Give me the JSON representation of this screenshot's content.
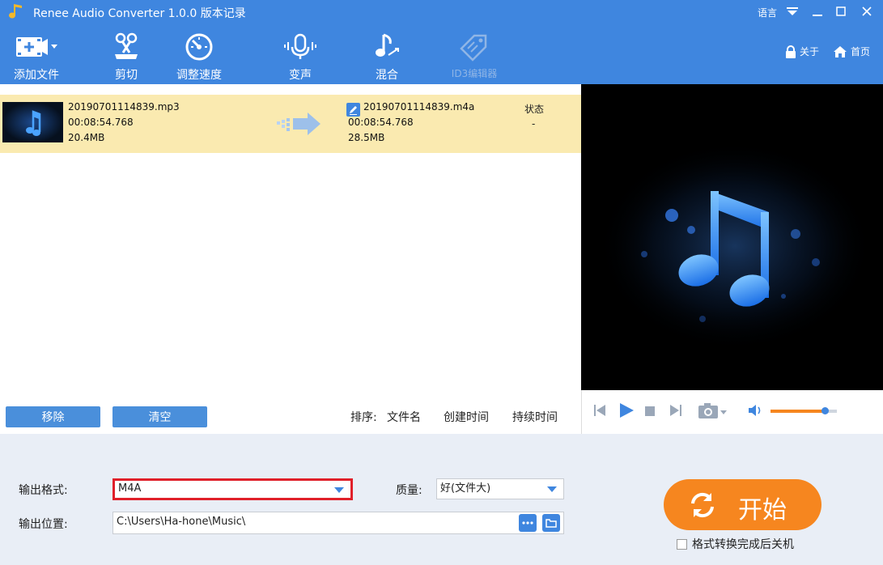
{
  "titlebar": {
    "title": "Renee Audio Converter 1.0.0 版本记录",
    "language_label": "语言"
  },
  "toolbar": {
    "items": [
      {
        "label": "添加文件",
        "icon": "add-file-icon",
        "enabled": true
      },
      {
        "label": "剪切",
        "icon": "scissors-icon",
        "enabled": true
      },
      {
        "label": "调整速度",
        "icon": "speed-gauge-icon",
        "enabled": true
      },
      {
        "label": "变声",
        "icon": "microphone-icon",
        "enabled": true
      },
      {
        "label": "混合",
        "icon": "music-mix-icon",
        "enabled": true
      },
      {
        "label": "ID3编辑器",
        "icon": "tag-icon",
        "enabled": false
      }
    ],
    "about_label": "关于",
    "home_label": "首页"
  },
  "file": {
    "src_name": "20190701114839.mp3",
    "src_duration": "00:08:54.768",
    "src_size": "20.4MB",
    "dst_name": "20190701114839.m4a",
    "dst_duration": "00:08:54.768",
    "dst_size": "28.5MB",
    "status_header": "状态",
    "status_value": "-"
  },
  "list_footer": {
    "remove_label": "移除",
    "clear_label": "清空",
    "sort_label": "排序:",
    "sort_filename": "文件名",
    "sort_created": "创建时间",
    "sort_duration": "持续时间"
  },
  "player": {
    "volume_level": 0.82
  },
  "settings": {
    "format_label": "输出格式:",
    "format_value": "M4A",
    "quality_label": "质量:",
    "quality_value": "好(文件大)",
    "output_label": "输出位置:",
    "output_path": "C:\\Users\\Ha-hone\\Music\\",
    "start_label": "开始",
    "shutdown_label": "格式转换完成后关机"
  },
  "colors": {
    "toolbar_bg": "#3f86df",
    "row_highlight": "#faeab0",
    "start_button": "#f6861f",
    "format_highlight": "#e0202a"
  }
}
